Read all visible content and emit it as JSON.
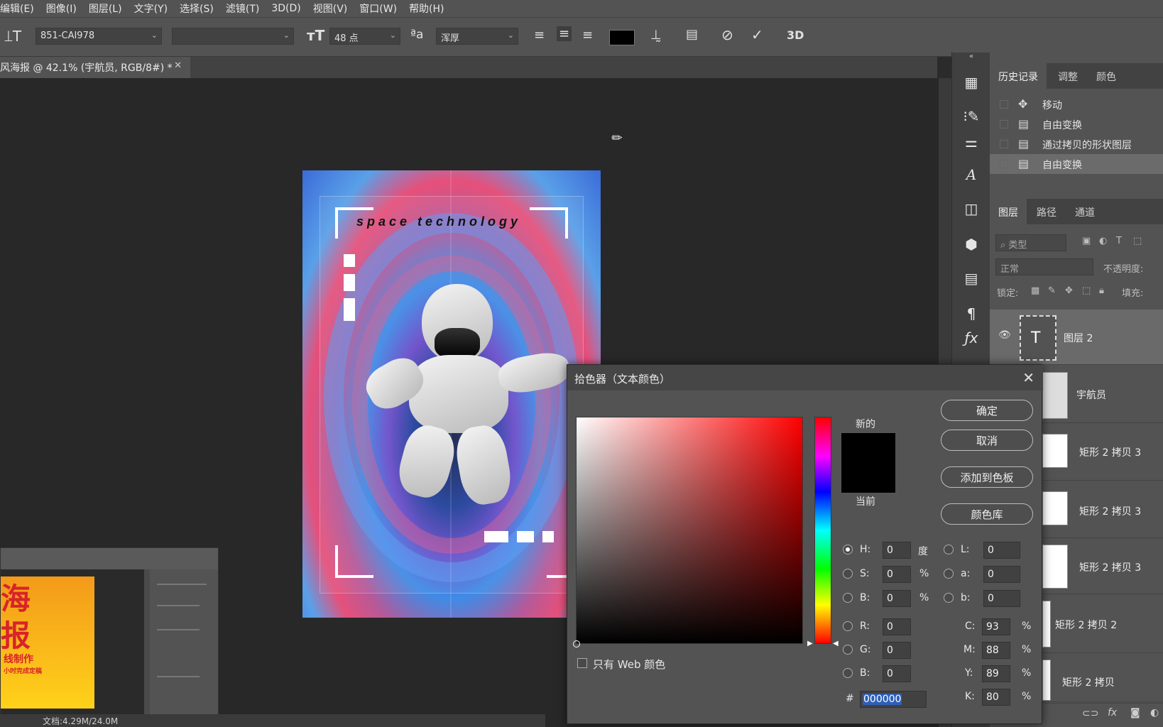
{
  "menu": [
    "编辑(E)",
    "图像(I)",
    "图层(L)",
    "文字(Y)",
    "选择(S)",
    "滤镜(T)",
    "3D(D)",
    "视图(V)",
    "窗口(W)",
    "帮助(H)"
  ],
  "options": {
    "font_family": "851-CAI978",
    "font_style": "",
    "font_size": "48 点",
    "antialias": "浑厚",
    "text_color": "#000000",
    "threed_label": "3D"
  },
  "document": {
    "tab_title": "风海报 @ 42.1% (宇航员, RGB/8#) *",
    "status": "文档:4.29M/24.0M"
  },
  "poster": {
    "title": "space technology"
  },
  "thumb": {
    "big1": "海",
    "big2": "报",
    "line1": "线制作",
    "line2": "小时完成定稿"
  },
  "history": {
    "tabs": [
      "历史记录",
      "调整",
      "颜色"
    ],
    "items": [
      {
        "label": "移动",
        "icon": "move-icon"
      },
      {
        "label": "自由变换",
        "icon": "doc-icon"
      },
      {
        "label": "通过拷贝的形状图层",
        "icon": "doc-icon"
      },
      {
        "label": "自由变换",
        "icon": "doc-icon",
        "selected": true
      }
    ]
  },
  "layers": {
    "tabs": [
      "图层",
      "路径",
      "通道"
    ],
    "filter_placeholder": "类型",
    "blend_mode": "正常",
    "opacity_label": "不透明度:",
    "lock_label": "锁定:",
    "fill_label": "填充:",
    "items": [
      {
        "name": "图层 2",
        "kind": "text",
        "selected": true
      },
      {
        "name": "宇航员"
      },
      {
        "name": "矩形 2 拷贝 3"
      },
      {
        "name": "矩形 2 拷贝 3"
      },
      {
        "name": "矩形 2 拷贝 3"
      },
      {
        "name": "矩形 2 拷贝 2"
      },
      {
        "name": "矩形 2 拷贝"
      }
    ]
  },
  "picker": {
    "title": "拾色器（文本颜色）",
    "new_label": "新的",
    "current_label": "当前",
    "ok": "确定",
    "cancel": "取消",
    "add_swatch": "添加到色板",
    "color_library": "颜色库",
    "web_only": "只有 Web 颜色",
    "hsb": {
      "H": "0",
      "S": "0",
      "B": "0",
      "h_unit": "度",
      "s_unit": "%",
      "b_unit": "%"
    },
    "lab": {
      "L": "0",
      "a": "0",
      "b": "0"
    },
    "rgb": {
      "R": "0",
      "G": "0",
      "B": "0"
    },
    "cmyk": {
      "C": "93",
      "M": "88",
      "Y": "89",
      "K": "80",
      "unit": "%"
    },
    "hex_label": "#",
    "hex": "000000"
  }
}
